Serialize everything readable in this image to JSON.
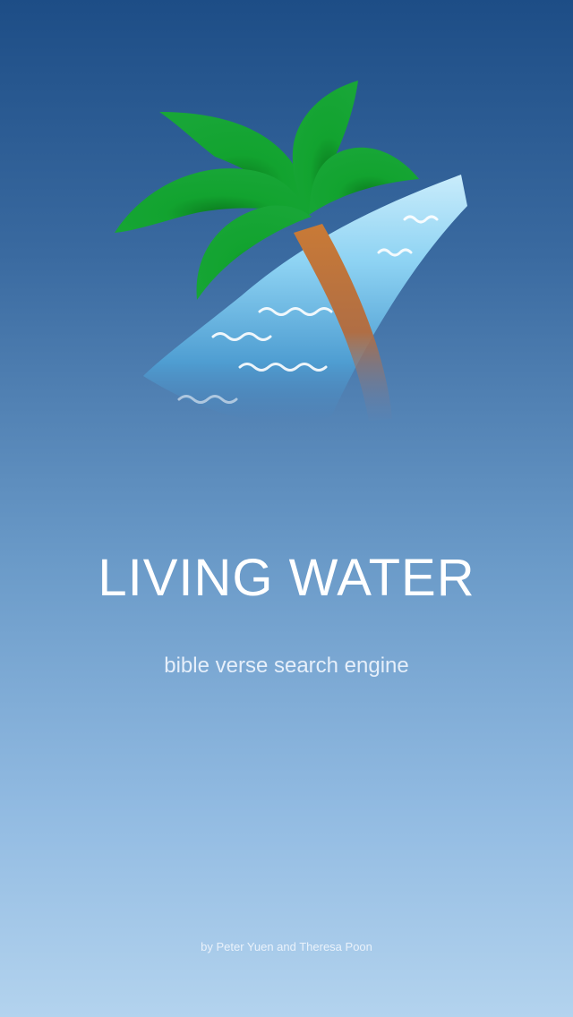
{
  "app": {
    "title": "LIVING WATER",
    "subtitle": "bible verse search engine",
    "credits": "by Peter Yuen and Theresa Poon"
  },
  "icons": {
    "logo": "palm-tree-water-logo"
  },
  "colors": {
    "background_top": "#1d4d86",
    "background_bottom": "#b3d3ee",
    "palm_leaves": "#12a030",
    "palm_trunk": "#c47a3c",
    "water": "#7cc8ee"
  }
}
